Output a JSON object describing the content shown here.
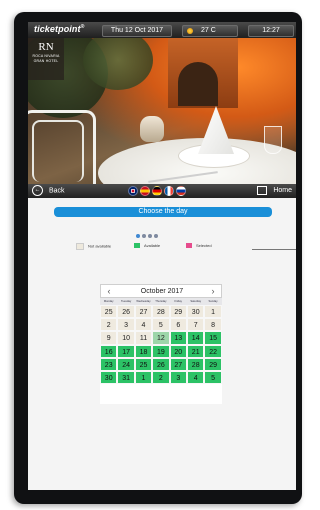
{
  "topbar": {
    "brand": "ticketpoint",
    "brand_mark": "®",
    "date": "Thu 12 Oct 2017",
    "temperature": "27 C",
    "weather_icon": "sun-icon",
    "time": "12:27"
  },
  "photo_logo": {
    "mark": "RN",
    "line1": "ROCA NIVARIA",
    "line2": "GRAN HOTEL"
  },
  "nav": {
    "back_label": "Back",
    "home_label": "Home",
    "languages": [
      "English",
      "Spanish",
      "German",
      "French",
      "Russian"
    ]
  },
  "content": {
    "title": "Choose the day",
    "step_dots": 4,
    "active_step": 0,
    "legend": {
      "not_available": "Not available",
      "available": "Available",
      "selected": "Selected"
    },
    "legend_colors": {
      "not_available": "#eee9dd",
      "available": "#2cc266",
      "selected": "#e64c8d"
    }
  },
  "calendar": {
    "month_label": "October 2017",
    "prev_icon": "chevron-left-icon",
    "next_icon": "chevron-right-icon",
    "weekdays": [
      "Monday",
      "Tuesday",
      "Wednesday",
      "Thursday",
      "Friday",
      "Saturday",
      "Sunday"
    ],
    "weeks": [
      [
        {
          "d": "25",
          "s": "na"
        },
        {
          "d": "26",
          "s": "na"
        },
        {
          "d": "27",
          "s": "na"
        },
        {
          "d": "28",
          "s": "na"
        },
        {
          "d": "29",
          "s": "na"
        },
        {
          "d": "30",
          "s": "na"
        },
        {
          "d": "1",
          "s": "na"
        }
      ],
      [
        {
          "d": "2",
          "s": "na"
        },
        {
          "d": "3",
          "s": "na"
        },
        {
          "d": "4",
          "s": "na"
        },
        {
          "d": "5",
          "s": "na"
        },
        {
          "d": "6",
          "s": "na"
        },
        {
          "d": "7",
          "s": "na"
        },
        {
          "d": "8",
          "s": "na"
        }
      ],
      [
        {
          "d": "9",
          "s": "na"
        },
        {
          "d": "10",
          "s": "na"
        },
        {
          "d": "11",
          "s": "na"
        },
        {
          "d": "12",
          "s": "today"
        },
        {
          "d": "13",
          "s": "av"
        },
        {
          "d": "14",
          "s": "av"
        },
        {
          "d": "15",
          "s": "av"
        }
      ],
      [
        {
          "d": "16",
          "s": "av"
        },
        {
          "d": "17",
          "s": "av"
        },
        {
          "d": "18",
          "s": "av"
        },
        {
          "d": "19",
          "s": "av"
        },
        {
          "d": "20",
          "s": "av"
        },
        {
          "d": "21",
          "s": "av"
        },
        {
          "d": "22",
          "s": "av"
        }
      ],
      [
        {
          "d": "23",
          "s": "av"
        },
        {
          "d": "24",
          "s": "av"
        },
        {
          "d": "25",
          "s": "av"
        },
        {
          "d": "26",
          "s": "av"
        },
        {
          "d": "27",
          "s": "av"
        },
        {
          "d": "28",
          "s": "av"
        },
        {
          "d": "29",
          "s": "av"
        }
      ],
      [
        {
          "d": "30",
          "s": "av"
        },
        {
          "d": "31",
          "s": "av"
        },
        {
          "d": "1",
          "s": "av"
        },
        {
          "d": "2",
          "s": "av"
        },
        {
          "d": "3",
          "s": "av"
        },
        {
          "d": "4",
          "s": "av"
        },
        {
          "d": "5",
          "s": "av"
        }
      ]
    ]
  }
}
